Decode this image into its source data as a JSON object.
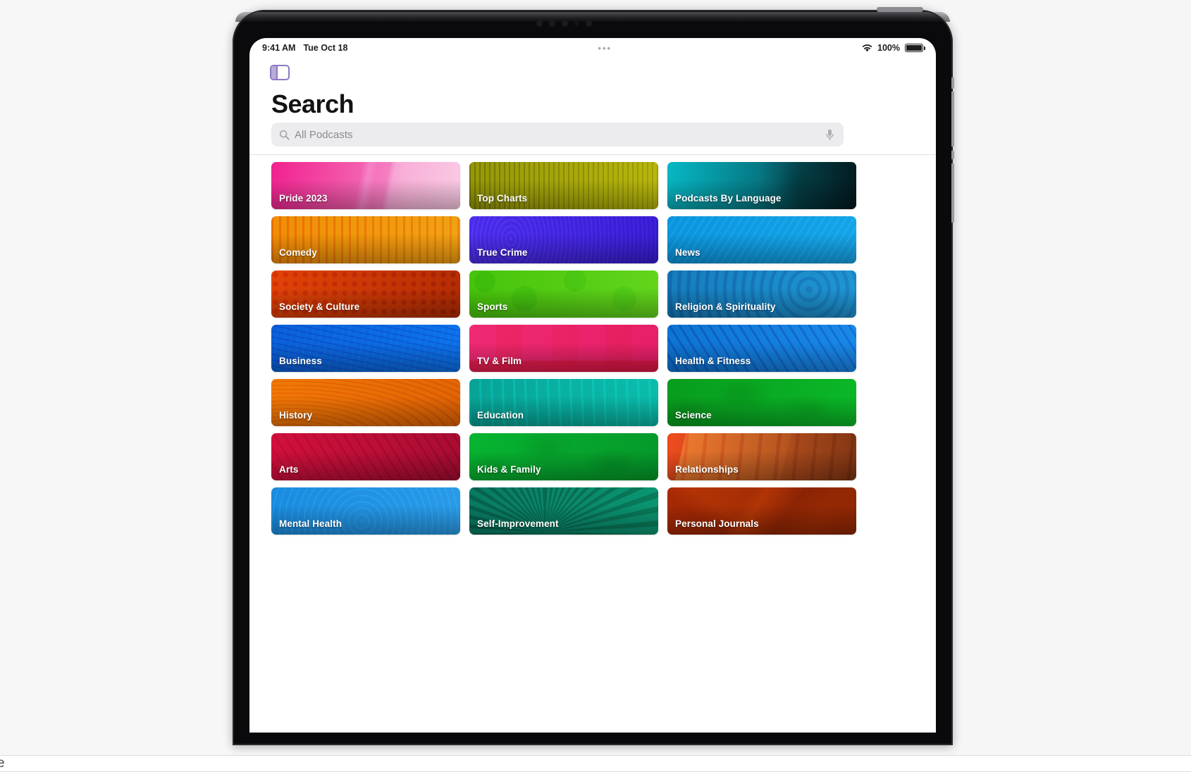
{
  "page": {
    "cut_off_text": "e"
  },
  "device": {
    "name": "ipad",
    "camera_dots": 4
  },
  "status_bar": {
    "time": "9:41 AM",
    "date": "Tue Oct 18",
    "multitask_indicator": "•••",
    "wifi_icon": "wifi-icon",
    "battery_percent": "100%",
    "battery_icon": "battery-icon"
  },
  "toolbar": {
    "sidebar_toggle_icon": "sidebar-toggle-icon"
  },
  "header": {
    "title": "Search"
  },
  "search": {
    "placeholder": "All Podcasts",
    "value": "",
    "search_icon": "search-icon",
    "mic_icon": "microphone-icon"
  },
  "categories": [
    {
      "label": "Pride 2023",
      "c1": "#f0218f",
      "c2": "#f7a8d4",
      "tex": "tx-splitpink"
    },
    {
      "label": "Top Charts",
      "c1": "#8d8f07",
      "c2": "#b4b30c",
      "tex": "tx-vbars2"
    },
    {
      "label": "Podcasts By Language",
      "c1": "#07b9c6",
      "c2": "#04303a",
      "tex": "tx-face"
    },
    {
      "label": "Comedy",
      "c1": "#ef8f04",
      "c2": "#f0a313",
      "tex": "tx-vbars"
    },
    {
      "label": "True Crime",
      "c1": "#5232ef",
      "c2": "#3b1fd6",
      "tex": "tx-fingerprint"
    },
    {
      "label": "News",
      "c1": "#0e9ae0",
      "c2": "#17a9ea",
      "tex": "tx-diag2"
    },
    {
      "label": "Society & Culture",
      "c1": "#e14407",
      "c2": "#b32c04",
      "tex": "tx-dots"
    },
    {
      "label": "Sports",
      "c1": "#46c40b",
      "c2": "#63d61c",
      "tex": "tx-circles"
    },
    {
      "label": "Religion & Spirituality",
      "c1": "#1478b8",
      "c2": "#1e92cf",
      "tex": "tx-swirl"
    },
    {
      "label": "Business",
      "c1": "#0b5fd6",
      "c2": "#0d72e8",
      "tex": "tx-mesh"
    },
    {
      "label": "TV & Film",
      "c1": "#ef2a73",
      "c2": "#e71f67",
      "tex": "tx-tvbands"
    },
    {
      "label": "Health & Fitness",
      "c1": "#0d74cf",
      "c2": "#1a8ae6",
      "tex": "tx-diag"
    },
    {
      "label": "History",
      "c1": "#ef7a06",
      "c2": "#e06604",
      "tex": "tx-arcs"
    },
    {
      "label": "Education",
      "c1": "#07a79b",
      "c2": "#0cc4b4",
      "tex": "tx-shelf"
    },
    {
      "label": "Science",
      "c1": "#089c1e",
      "c2": "#0ab828",
      "tex": "tx-blobs"
    },
    {
      "label": "Arts",
      "c1": "#d2103f",
      "c2": "#a80c33",
      "tex": "tx-diag"
    },
    {
      "label": "Kids & Family",
      "c1": "#07b431",
      "c2": "#05992a",
      "tex": "tx-blobs"
    },
    {
      "label": "Relationships",
      "c1": "#f58032",
      "c2": "#8c3a14",
      "tex": "tx-hand"
    },
    {
      "label": "Mental Health",
      "c1": "#1b8ae0",
      "c2": "#2a9ae8",
      "tex": "tx-rings"
    },
    {
      "label": "Self-Improvement",
      "c1": "#07735c",
      "c2": "#0a8f6c",
      "tex": "tx-petal"
    },
    {
      "label": "Personal Journals",
      "c1": "#b83505",
      "c2": "#8f2604",
      "tex": "tx-book"
    }
  ]
}
